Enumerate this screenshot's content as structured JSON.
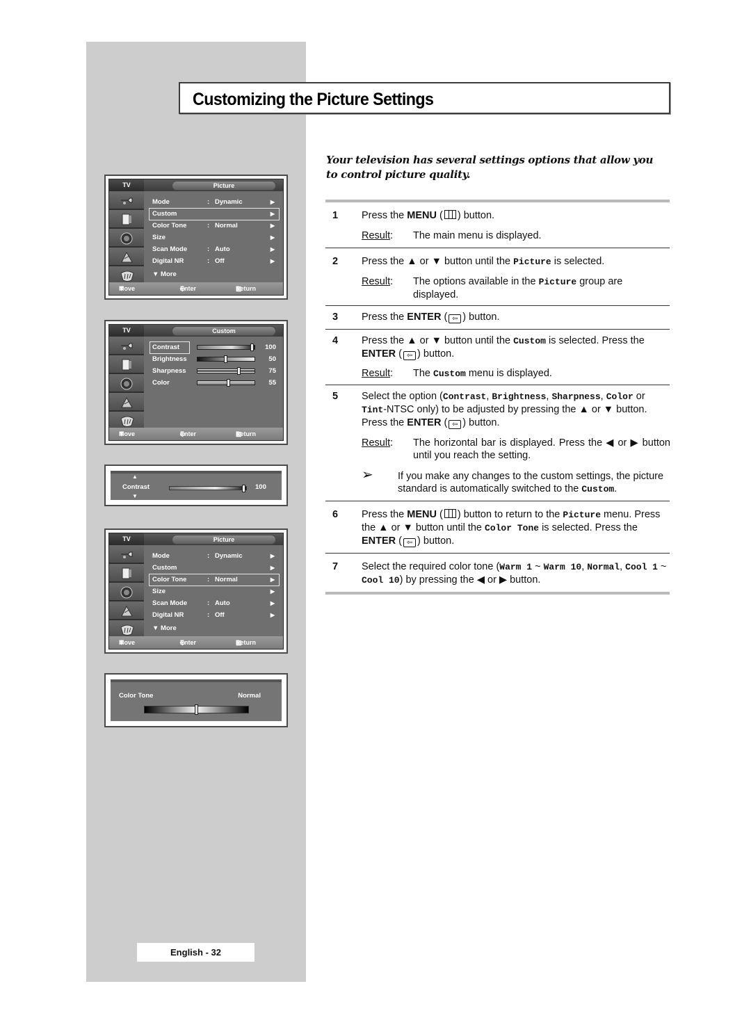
{
  "title": "Customizing the Picture Settings",
  "intro": "Your television has several settings options that allow you to control picture quality.",
  "osd_common": {
    "tv_label": "TV",
    "footer": {
      "move": "Move",
      "enter": "Enter",
      "return": "Return"
    },
    "sidebar_icons": [
      "input-plug-icon",
      "picture-monitor-icon",
      "speaker-sound-icon",
      "channel-dish-icon",
      "setup-tools-icon"
    ]
  },
  "osd_picture_1": {
    "tab": "Picture",
    "selected": "Custom",
    "rows": [
      {
        "label": "Mode",
        "value": "Dynamic"
      },
      {
        "label": "Custom",
        "value": ""
      },
      {
        "label": "Color Tone",
        "value": "Normal"
      },
      {
        "label": "Size",
        "value": ""
      },
      {
        "label": "Scan Mode",
        "value": "Auto"
      },
      {
        "label": "Digital NR",
        "value": "Off"
      }
    ],
    "more": "More"
  },
  "osd_custom": {
    "tab": "Custom",
    "selected": "Contrast",
    "sliders": [
      {
        "label": "Contrast",
        "value": 100,
        "max": 100
      },
      {
        "label": "Brightness",
        "value": 50,
        "max": 100
      },
      {
        "label": "Sharpness",
        "value": 75,
        "max": 100
      },
      {
        "label": "Color",
        "value": 55,
        "max": 100
      }
    ]
  },
  "osd_contrast_bar": {
    "label": "Contrast",
    "value": 100,
    "max": 100
  },
  "osd_picture_2": {
    "tab": "Picture",
    "selected": "Color Tone",
    "rows": [
      {
        "label": "Mode",
        "value": "Dynamic"
      },
      {
        "label": "Custom",
        "value": ""
      },
      {
        "label": "Color Tone",
        "value": "Normal"
      },
      {
        "label": "Size",
        "value": ""
      },
      {
        "label": "Scan Mode",
        "value": "Auto"
      },
      {
        "label": "Digital NR",
        "value": "Off"
      }
    ],
    "more": "More"
  },
  "osd_color_tone_bar": {
    "label": "Color Tone",
    "value_text": "Normal",
    "position_fraction": 0.5
  },
  "steps": {
    "s1": {
      "num": "1",
      "a": "Press the ",
      "b": "MENU",
      "c": " button.",
      "result_label": "Result",
      "result": "The main menu is displayed."
    },
    "s2": {
      "num": "2",
      "a": "Press the ▲ or ▼ button until the ",
      "code": "Picture",
      "c": " is selected.",
      "result_label": "Result",
      "r1": "The options available in the ",
      "rcode": "Picture",
      "r2": " group are displayed."
    },
    "s3": {
      "num": "3",
      "a": "Press the ",
      "b": "ENTER",
      "c": " button."
    },
    "s4": {
      "num": "4",
      "a": "Press the ▲ or ▼ button until the ",
      "code": "Custom",
      "c": " is selected. Press the ",
      "b": "ENTER",
      "d": " button.",
      "result_label": "Result",
      "r1": "The ",
      "rcode": "Custom",
      "r2": " menu is displayed."
    },
    "s5": {
      "num": "5",
      "a": "Select the option (",
      "o1": "Contrast",
      "sep1": ", ",
      "o2": "Brightness",
      "sep2": ", ",
      "o3": "Sharpness",
      "sep3": ", ",
      "o4": "Color",
      "or": " or ",
      "o5": "Tint",
      "b": "-NTSC only) to be adjusted by pressing the ▲ or ▼ button. Press the ",
      "enter": "ENTER",
      "c": " button.",
      "result_label": "Result",
      "result": "The horizontal bar is displayed. Press the ◀ or ▶ button until you reach the setting.",
      "note": "If you make any changes to the custom settings, the picture standard is automatically switched to the ",
      "note_code": "Custom",
      "note_end": "."
    },
    "s6": {
      "num": "6",
      "a": "Press the ",
      "menu": "MENU",
      "b": " button to return to the ",
      "code1": "Picture",
      "c": " menu. Press the ▲ or ▼ button until the ",
      "code2": "Color Tone",
      "d": " is selected. Press the ",
      "enter": "ENTER",
      "e": " button."
    },
    "s7": {
      "num": "7",
      "a": "Select the required color tone (",
      "c1": "Warm 1",
      "t1": " ~ ",
      "c2": "Warm 10",
      "t2": ", ",
      "c3": "Normal",
      "t3": ", ",
      "c4": "Cool 1",
      "t4": " ~ ",
      "c5": "Cool 10",
      "b": ") by pressing the ◀ or ▶ button."
    }
  },
  "footer": "English - 32"
}
